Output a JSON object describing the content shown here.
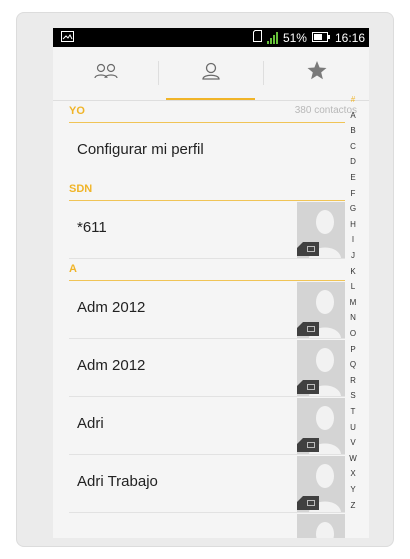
{
  "status_bar": {
    "battery": "51%",
    "time": "16:16"
  },
  "tabs": [
    {
      "icon": "groups-icon"
    },
    {
      "icon": "contact-person-icon"
    },
    {
      "icon": "star-icon"
    }
  ],
  "sections": [
    {
      "label": "YO",
      "count": "380 contactos"
    },
    {
      "label": "SDN"
    },
    {
      "label": "A"
    }
  ],
  "profile_row": {
    "label": "Configurar mi perfil"
  },
  "contacts": [
    {
      "name": "*611"
    },
    {
      "name": "Adm 2012"
    },
    {
      "name": "Adm 2012"
    },
    {
      "name": "Adri"
    },
    {
      "name": "Adri Trabajo"
    }
  ],
  "alphabet": [
    "#",
    "A",
    "B",
    "C",
    "D",
    "E",
    "F",
    "G",
    "H",
    "I",
    "J",
    "K",
    "L",
    "M",
    "N",
    "O",
    "P",
    "Q",
    "R",
    "S",
    "T",
    "U",
    "V",
    "W",
    "X",
    "Y",
    "Z"
  ],
  "colors": {
    "accent": "#f0b428",
    "signal": "#67c23a"
  }
}
